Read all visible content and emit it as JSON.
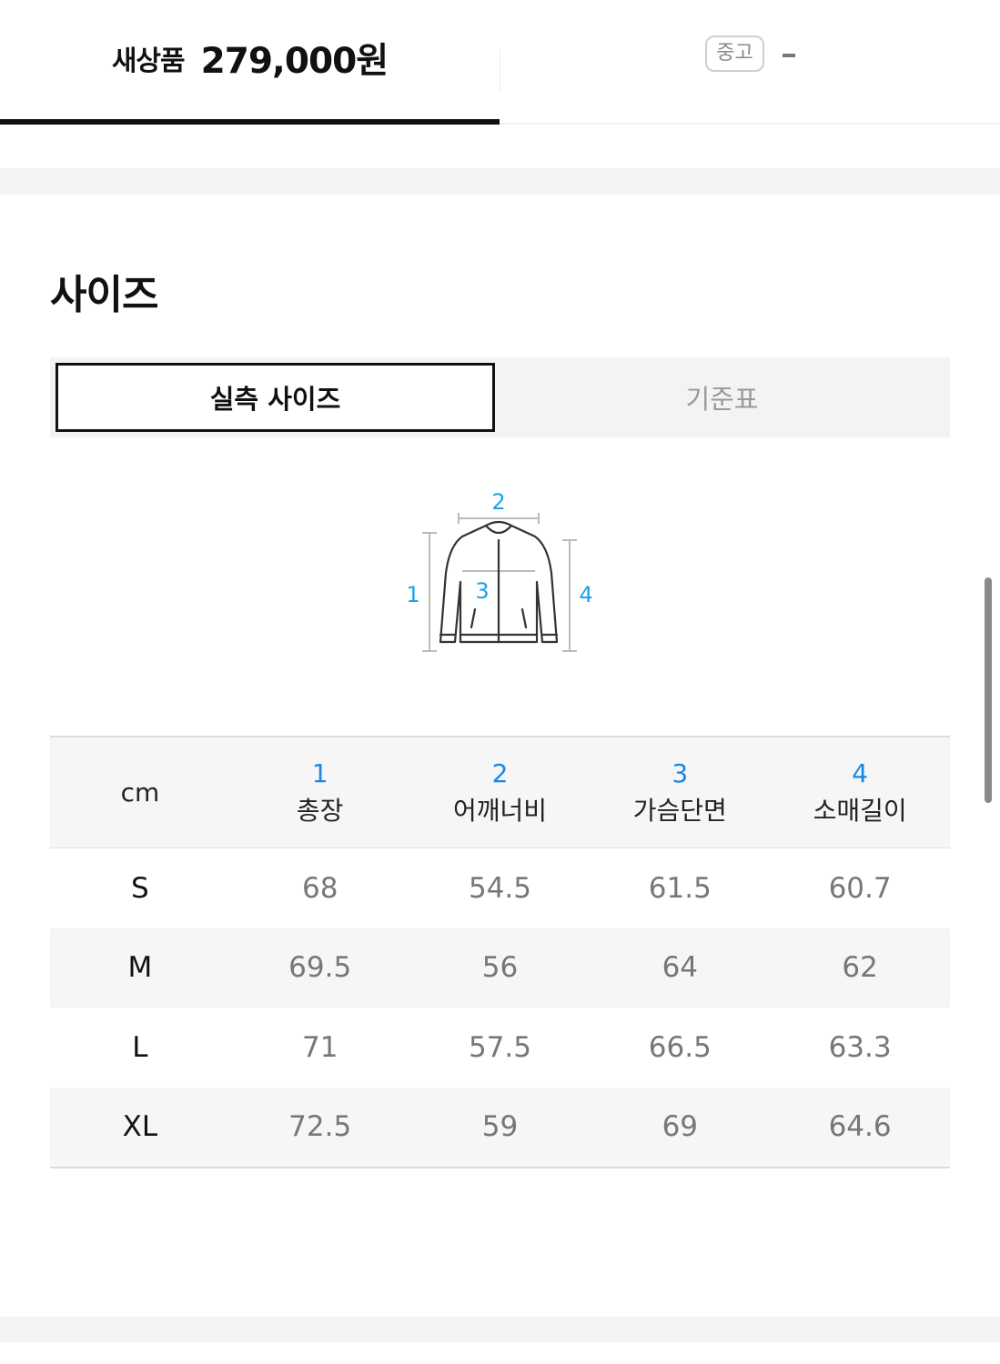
{
  "price_tabs": {
    "new": {
      "label": "새상품",
      "price": "279,000원"
    },
    "used": {
      "badge": "중고",
      "price": "-"
    }
  },
  "size_section": {
    "title": "사이즈",
    "tabs": {
      "active": "실측 사이즈",
      "inactive": "기준표"
    },
    "diagram": {
      "labels": [
        "1",
        "2",
        "3",
        "4"
      ],
      "accent_color": "#1aa3e8"
    },
    "table": {
      "unit": "cm",
      "columns": [
        {
          "num": "1",
          "name": "총장"
        },
        {
          "num": "2",
          "name": "어깨너비"
        },
        {
          "num": "3",
          "name": "가슴단면"
        },
        {
          "num": "4",
          "name": "소매길이"
        }
      ],
      "rows": [
        {
          "size": "S",
          "values": [
            "68",
            "54.5",
            "61.5",
            "60.7"
          ]
        },
        {
          "size": "M",
          "values": [
            "69.5",
            "56",
            "64",
            "62"
          ]
        },
        {
          "size": "L",
          "values": [
            "71",
            "57.5",
            "66.5",
            "63.3"
          ]
        },
        {
          "size": "XL",
          "values": [
            "72.5",
            "59",
            "69",
            "64.6"
          ]
        }
      ]
    }
  },
  "colors": {
    "accent_blue": "#1a86e8",
    "text_dark": "#111111",
    "text_muted": "#777777"
  }
}
